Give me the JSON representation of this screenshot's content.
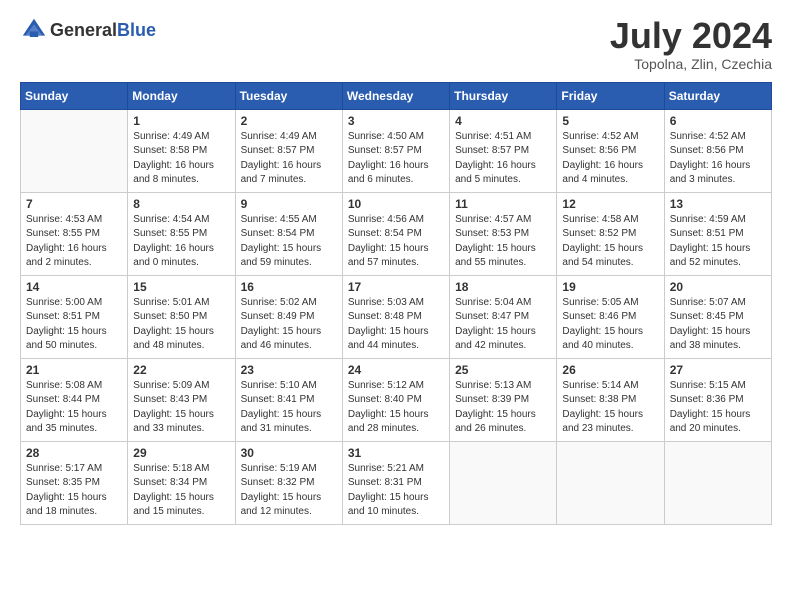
{
  "header": {
    "logo_general": "General",
    "logo_blue": "Blue",
    "month_title": "July 2024",
    "location": "Topolna, Zlin, Czechia"
  },
  "days_of_week": [
    "Sunday",
    "Monday",
    "Tuesday",
    "Wednesday",
    "Thursday",
    "Friday",
    "Saturday"
  ],
  "weeks": [
    [
      {
        "day": "",
        "info": ""
      },
      {
        "day": "1",
        "info": "Sunrise: 4:49 AM\nSunset: 8:58 PM\nDaylight: 16 hours\nand 8 minutes."
      },
      {
        "day": "2",
        "info": "Sunrise: 4:49 AM\nSunset: 8:57 PM\nDaylight: 16 hours\nand 7 minutes."
      },
      {
        "day": "3",
        "info": "Sunrise: 4:50 AM\nSunset: 8:57 PM\nDaylight: 16 hours\nand 6 minutes."
      },
      {
        "day": "4",
        "info": "Sunrise: 4:51 AM\nSunset: 8:57 PM\nDaylight: 16 hours\nand 5 minutes."
      },
      {
        "day": "5",
        "info": "Sunrise: 4:52 AM\nSunset: 8:56 PM\nDaylight: 16 hours\nand 4 minutes."
      },
      {
        "day": "6",
        "info": "Sunrise: 4:52 AM\nSunset: 8:56 PM\nDaylight: 16 hours\nand 3 minutes."
      }
    ],
    [
      {
        "day": "7",
        "info": "Sunrise: 4:53 AM\nSunset: 8:55 PM\nDaylight: 16 hours\nand 2 minutes."
      },
      {
        "day": "8",
        "info": "Sunrise: 4:54 AM\nSunset: 8:55 PM\nDaylight: 16 hours\nand 0 minutes."
      },
      {
        "day": "9",
        "info": "Sunrise: 4:55 AM\nSunset: 8:54 PM\nDaylight: 15 hours\nand 59 minutes."
      },
      {
        "day": "10",
        "info": "Sunrise: 4:56 AM\nSunset: 8:54 PM\nDaylight: 15 hours\nand 57 minutes."
      },
      {
        "day": "11",
        "info": "Sunrise: 4:57 AM\nSunset: 8:53 PM\nDaylight: 15 hours\nand 55 minutes."
      },
      {
        "day": "12",
        "info": "Sunrise: 4:58 AM\nSunset: 8:52 PM\nDaylight: 15 hours\nand 54 minutes."
      },
      {
        "day": "13",
        "info": "Sunrise: 4:59 AM\nSunset: 8:51 PM\nDaylight: 15 hours\nand 52 minutes."
      }
    ],
    [
      {
        "day": "14",
        "info": "Sunrise: 5:00 AM\nSunset: 8:51 PM\nDaylight: 15 hours\nand 50 minutes."
      },
      {
        "day": "15",
        "info": "Sunrise: 5:01 AM\nSunset: 8:50 PM\nDaylight: 15 hours\nand 48 minutes."
      },
      {
        "day": "16",
        "info": "Sunrise: 5:02 AM\nSunset: 8:49 PM\nDaylight: 15 hours\nand 46 minutes."
      },
      {
        "day": "17",
        "info": "Sunrise: 5:03 AM\nSunset: 8:48 PM\nDaylight: 15 hours\nand 44 minutes."
      },
      {
        "day": "18",
        "info": "Sunrise: 5:04 AM\nSunset: 8:47 PM\nDaylight: 15 hours\nand 42 minutes."
      },
      {
        "day": "19",
        "info": "Sunrise: 5:05 AM\nSunset: 8:46 PM\nDaylight: 15 hours\nand 40 minutes."
      },
      {
        "day": "20",
        "info": "Sunrise: 5:07 AM\nSunset: 8:45 PM\nDaylight: 15 hours\nand 38 minutes."
      }
    ],
    [
      {
        "day": "21",
        "info": "Sunrise: 5:08 AM\nSunset: 8:44 PM\nDaylight: 15 hours\nand 35 minutes."
      },
      {
        "day": "22",
        "info": "Sunrise: 5:09 AM\nSunset: 8:43 PM\nDaylight: 15 hours\nand 33 minutes."
      },
      {
        "day": "23",
        "info": "Sunrise: 5:10 AM\nSunset: 8:41 PM\nDaylight: 15 hours\nand 31 minutes."
      },
      {
        "day": "24",
        "info": "Sunrise: 5:12 AM\nSunset: 8:40 PM\nDaylight: 15 hours\nand 28 minutes."
      },
      {
        "day": "25",
        "info": "Sunrise: 5:13 AM\nSunset: 8:39 PM\nDaylight: 15 hours\nand 26 minutes."
      },
      {
        "day": "26",
        "info": "Sunrise: 5:14 AM\nSunset: 8:38 PM\nDaylight: 15 hours\nand 23 minutes."
      },
      {
        "day": "27",
        "info": "Sunrise: 5:15 AM\nSunset: 8:36 PM\nDaylight: 15 hours\nand 20 minutes."
      }
    ],
    [
      {
        "day": "28",
        "info": "Sunrise: 5:17 AM\nSunset: 8:35 PM\nDaylight: 15 hours\nand 18 minutes."
      },
      {
        "day": "29",
        "info": "Sunrise: 5:18 AM\nSunset: 8:34 PM\nDaylight: 15 hours\nand 15 minutes."
      },
      {
        "day": "30",
        "info": "Sunrise: 5:19 AM\nSunset: 8:32 PM\nDaylight: 15 hours\nand 12 minutes."
      },
      {
        "day": "31",
        "info": "Sunrise: 5:21 AM\nSunset: 8:31 PM\nDaylight: 15 hours\nand 10 minutes."
      },
      {
        "day": "",
        "info": ""
      },
      {
        "day": "",
        "info": ""
      },
      {
        "day": "",
        "info": ""
      }
    ]
  ]
}
